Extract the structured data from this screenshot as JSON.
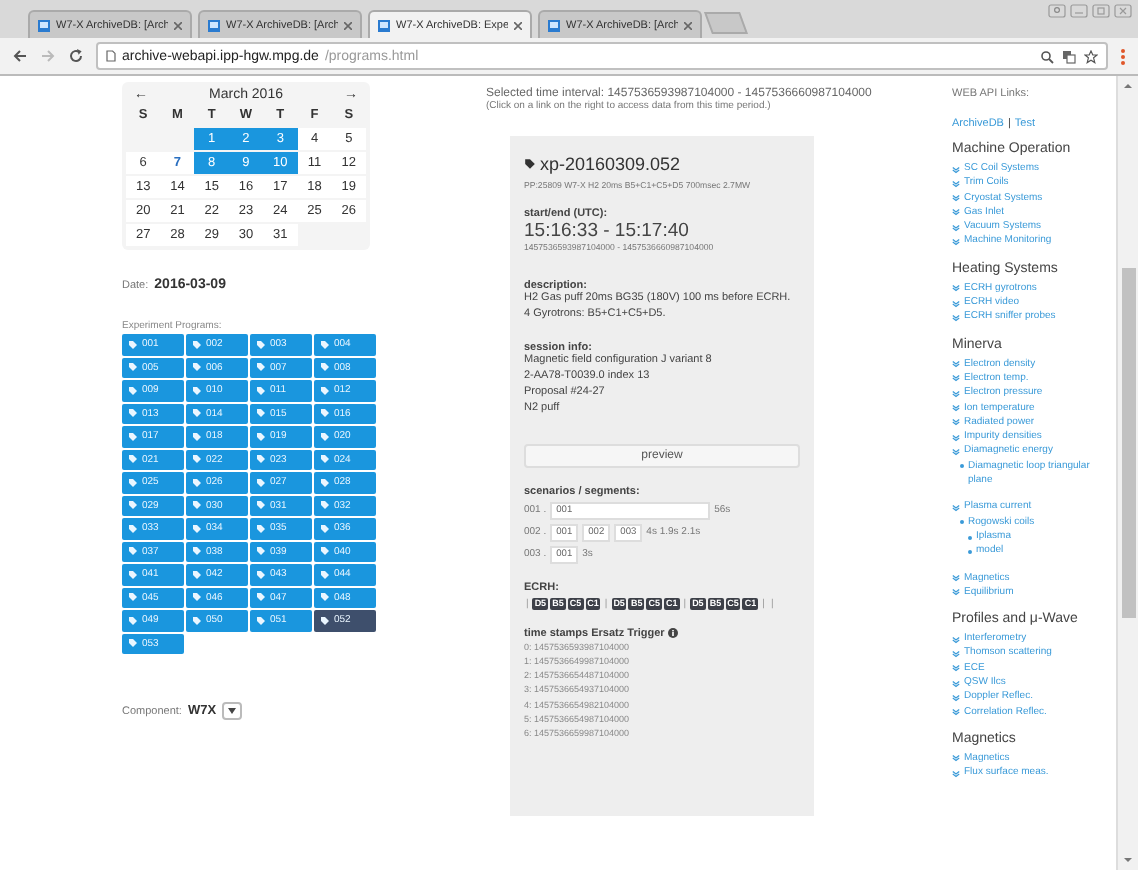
{
  "browser": {
    "tabs": [
      {
        "title": "W7-X ArchiveDB: [Arch",
        "selected": false
      },
      {
        "title": "W7-X ArchiveDB: [Arch",
        "selected": false
      },
      {
        "title": "W7-X ArchiveDB: Expe",
        "selected": true
      },
      {
        "title": "W7-X ArchiveDB: [Arch",
        "selected": false
      }
    ],
    "url_host": "archive-webapi.ipp-hgw.mpg.de",
    "url_path": "/programs.html"
  },
  "calendar": {
    "prev": "←",
    "title": "March 2016",
    "next": "→",
    "weekdays": [
      "S",
      "M",
      "T",
      "W",
      "T",
      "F",
      "S"
    ],
    "weeks": [
      [
        {
          "day": "1",
          "selected": true,
          "today": false
        },
        {
          "day": "2",
          "selected": true,
          "today": false
        },
        {
          "day": "3",
          "selected": true,
          "today": false
        },
        {
          "day": "4",
          "selected": false,
          "today": false
        },
        {
          "day": "5",
          "selected": false,
          "today": false
        }
      ],
      [
        {
          "day": "6",
          "selected": false,
          "today": false
        },
        {
          "day": "7",
          "selected": false,
          "today": true
        },
        {
          "day": "8",
          "selected": true,
          "today": false
        },
        {
          "day": "9",
          "selected": true,
          "today": false
        },
        {
          "day": "10",
          "selected": true,
          "today": false
        },
        {
          "day": "11",
          "selected": false,
          "today": false
        },
        {
          "day": "12",
          "selected": false,
          "today": false
        }
      ],
      [
        {
          "day": "13",
          "selected": false,
          "today": false
        },
        {
          "day": "14",
          "selected": false,
          "today": false
        },
        {
          "day": "15",
          "selected": false,
          "today": false
        },
        {
          "day": "16",
          "selected": false,
          "today": false
        },
        {
          "day": "17",
          "selected": false,
          "today": false
        },
        {
          "day": "18",
          "selected": false,
          "today": false
        },
        {
          "day": "19",
          "selected": false,
          "today": false
        }
      ],
      [
        {
          "day": "20",
          "selected": false,
          "today": false
        },
        {
          "day": "21",
          "selected": false,
          "today": false
        },
        {
          "day": "22",
          "selected": false,
          "today": false
        },
        {
          "day": "23",
          "selected": false,
          "today": false
        },
        {
          "day": "24",
          "selected": false,
          "today": false
        },
        {
          "day": "25",
          "selected": false,
          "today": false
        },
        {
          "day": "26",
          "selected": false,
          "today": false
        }
      ],
      [
        {
          "day": "27",
          "selected": false,
          "today": false
        },
        {
          "day": "28",
          "selected": false,
          "today": false
        },
        {
          "day": "29",
          "selected": false,
          "today": false
        },
        {
          "day": "30",
          "selected": false,
          "today": false
        },
        {
          "day": "31",
          "selected": false,
          "today": false
        }
      ]
    ]
  },
  "date": {
    "label": "Date:",
    "value": "2016-03-09"
  },
  "programs": {
    "label": "Experiment Programs:",
    "items": [
      {
        "label": "001",
        "selected": false
      },
      {
        "label": "002",
        "selected": false
      },
      {
        "label": "003",
        "selected": false
      },
      {
        "label": "004",
        "selected": false
      },
      {
        "label": "005",
        "selected": false
      },
      {
        "label": "006",
        "selected": false
      },
      {
        "label": "007",
        "selected": false
      },
      {
        "label": "008",
        "selected": false
      },
      {
        "label": "009",
        "selected": false
      },
      {
        "label": "010",
        "selected": false
      },
      {
        "label": "011",
        "selected": false
      },
      {
        "label": "012",
        "selected": false
      },
      {
        "label": "013",
        "selected": false
      },
      {
        "label": "014",
        "selected": false
      },
      {
        "label": "015",
        "selected": false
      },
      {
        "label": "016",
        "selected": false
      },
      {
        "label": "017",
        "selected": false
      },
      {
        "label": "018",
        "selected": false
      },
      {
        "label": "019",
        "selected": false
      },
      {
        "label": "020",
        "selected": false
      },
      {
        "label": "021",
        "selected": false
      },
      {
        "label": "022",
        "selected": false
      },
      {
        "label": "023",
        "selected": false
      },
      {
        "label": "024",
        "selected": false
      },
      {
        "label": "025",
        "selected": false
      },
      {
        "label": "026",
        "selected": false
      },
      {
        "label": "027",
        "selected": false
      },
      {
        "label": "028",
        "selected": false
      },
      {
        "label": "029",
        "selected": false
      },
      {
        "label": "030",
        "selected": false
      },
      {
        "label": "031",
        "selected": false
      },
      {
        "label": "032",
        "selected": false
      },
      {
        "label": "033",
        "selected": false
      },
      {
        "label": "034",
        "selected": false
      },
      {
        "label": "035",
        "selected": false
      },
      {
        "label": "036",
        "selected": false
      },
      {
        "label": "037",
        "selected": false
      },
      {
        "label": "038",
        "selected": false
      },
      {
        "label": "039",
        "selected": false
      },
      {
        "label": "040",
        "selected": false
      },
      {
        "label": "041",
        "selected": false
      },
      {
        "label": "042",
        "selected": false
      },
      {
        "label": "043",
        "selected": false
      },
      {
        "label": "044",
        "selected": false
      },
      {
        "label": "045",
        "selected": false
      },
      {
        "label": "046",
        "selected": false
      },
      {
        "label": "047",
        "selected": false
      },
      {
        "label": "048",
        "selected": false
      },
      {
        "label": "049",
        "selected": false
      },
      {
        "label": "050",
        "selected": false
      },
      {
        "label": "051",
        "selected": false
      },
      {
        "label": "052",
        "selected": true
      },
      {
        "label": "053",
        "selected": false
      }
    ]
  },
  "component": {
    "label": "Component:",
    "value": "W7X"
  },
  "interval": {
    "text": "Selected time interval: 1457536593987104000 - 1457536660987104000",
    "hint": "(Click on a link on the right to access data from this time period.)"
  },
  "program": {
    "id": "xp-20160309.052",
    "summary": "PP:25809 W7-X H2 20ms B5+C1+C5+D5 700msec 2.7MW",
    "startend_label": "start/end (UTC):",
    "startend": "15:16:33 - 15:17:40",
    "startend_ns": "1457536593987104000 - 1457536660987104000",
    "description_label": "description:",
    "description": [
      "H2 Gas puff 20ms BG35 (180V) 100 ms before ECRH.",
      "4 Gyrotrons: B5+C1+C5+D5."
    ],
    "session_label": "session info:",
    "session": [
      "Magnetic field configuration J variant 8",
      "2-AA78-T0039.0 index 13",
      "Proposal #24-27",
      "N2 puff"
    ],
    "preview": "preview",
    "scenarios_label": "scenarios / segments:",
    "scenarios": [
      {
        "number": "001 .",
        "segments": [
          {
            "label": "001",
            "kind": "long"
          }
        ],
        "durations": "56s"
      },
      {
        "number": "002 .",
        "segments": [
          {
            "label": "001",
            "kind": "short"
          },
          {
            "label": "002",
            "kind": "short"
          },
          {
            "label": "003",
            "kind": "short"
          }
        ],
        "durations": "4s 1.9s 2.1s"
      },
      {
        "number": "003 .",
        "segments": [
          {
            "label": "001",
            "kind": "short"
          }
        ],
        "durations": "3s"
      }
    ],
    "ecrh_label": "ECRH:",
    "ecrh": [
      {
        "kind": "bar",
        "text": "|"
      },
      {
        "kind": "chip",
        "text": "D5"
      },
      {
        "kind": "chip",
        "text": "B5"
      },
      {
        "kind": "chip",
        "text": "C5"
      },
      {
        "kind": "chip",
        "text": "C1"
      },
      {
        "kind": "bar",
        "text": "|"
      },
      {
        "kind": "chip",
        "text": "D5"
      },
      {
        "kind": "chip",
        "text": "B5"
      },
      {
        "kind": "chip",
        "text": "C5"
      },
      {
        "kind": "chip",
        "text": "C1"
      },
      {
        "kind": "bar",
        "text": "|"
      },
      {
        "kind": "chip",
        "text": "D5"
      },
      {
        "kind": "chip",
        "text": "B5"
      },
      {
        "kind": "chip",
        "text": "C5"
      },
      {
        "kind": "chip",
        "text": "C1"
      },
      {
        "kind": "bar",
        "text": "|"
      },
      {
        "kind": "bar",
        "text": "|"
      }
    ],
    "triggers_label": "time stamps Ersatz Trigger",
    "triggers": [
      "0: 1457536593987104000",
      "1: 1457536649987104000",
      "2: 1457536654487104000",
      "3: 1457536654937104000",
      "4: 1457536654982104000",
      "5: 1457536654987104000",
      "6: 1457536659987104000"
    ]
  },
  "links": {
    "label": "WEB API Links:",
    "api": [
      "ArchiveDB",
      "Test"
    ],
    "separator": "|",
    "sections": [
      {
        "title": "Machine Operation",
        "items": [
          {
            "label": "SC Coil Systems"
          },
          {
            "label": "Trim Coils"
          },
          {
            "label": "Cryostat Systems"
          },
          {
            "label": "Gas Inlet"
          },
          {
            "label": "Vacuum Systems"
          },
          {
            "label": "Machine Monitoring"
          }
        ]
      },
      {
        "title": "Heating Systems",
        "items": [
          {
            "label": "ECRH gyrotrons"
          },
          {
            "label": "ECRH video"
          },
          {
            "label": "ECRH sniffer probes"
          }
        ]
      },
      {
        "title": "Minerva",
        "items": [
          {
            "label": "Electron density"
          },
          {
            "label": "Electron temp."
          },
          {
            "label": "Electron pressure"
          },
          {
            "label": "Ion temperature"
          },
          {
            "label": "Radiated power"
          },
          {
            "label": "Impurity densities"
          },
          {
            "label": "Diamagnetic energy",
            "children": [
              {
                "label": "Diamagnetic loop triangular plane"
              }
            ]
          },
          {
            "label": "Plasma current",
            "children": [
              {
                "label": "Rogowski coils",
                "children": [
                  {
                    "label": "Iplasma"
                  },
                  {
                    "label": "model"
                  }
                ]
              }
            ]
          },
          {
            "label": "Magnetics"
          },
          {
            "label": "Equilibrium"
          }
        ]
      },
      {
        "title": "Profiles and μ-Wave",
        "items": [
          {
            "label": "Interferometry"
          },
          {
            "label": "Thomson scattering"
          },
          {
            "label": "ECE"
          },
          {
            "label": "QSW Ilcs"
          },
          {
            "label": "Doppler Reflec."
          },
          {
            "label": "Correlation Reflec."
          }
        ]
      },
      {
        "title": "Magnetics",
        "items": [
          {
            "label": "Magnetics"
          },
          {
            "label": "Flux surface meas."
          }
        ]
      }
    ]
  }
}
